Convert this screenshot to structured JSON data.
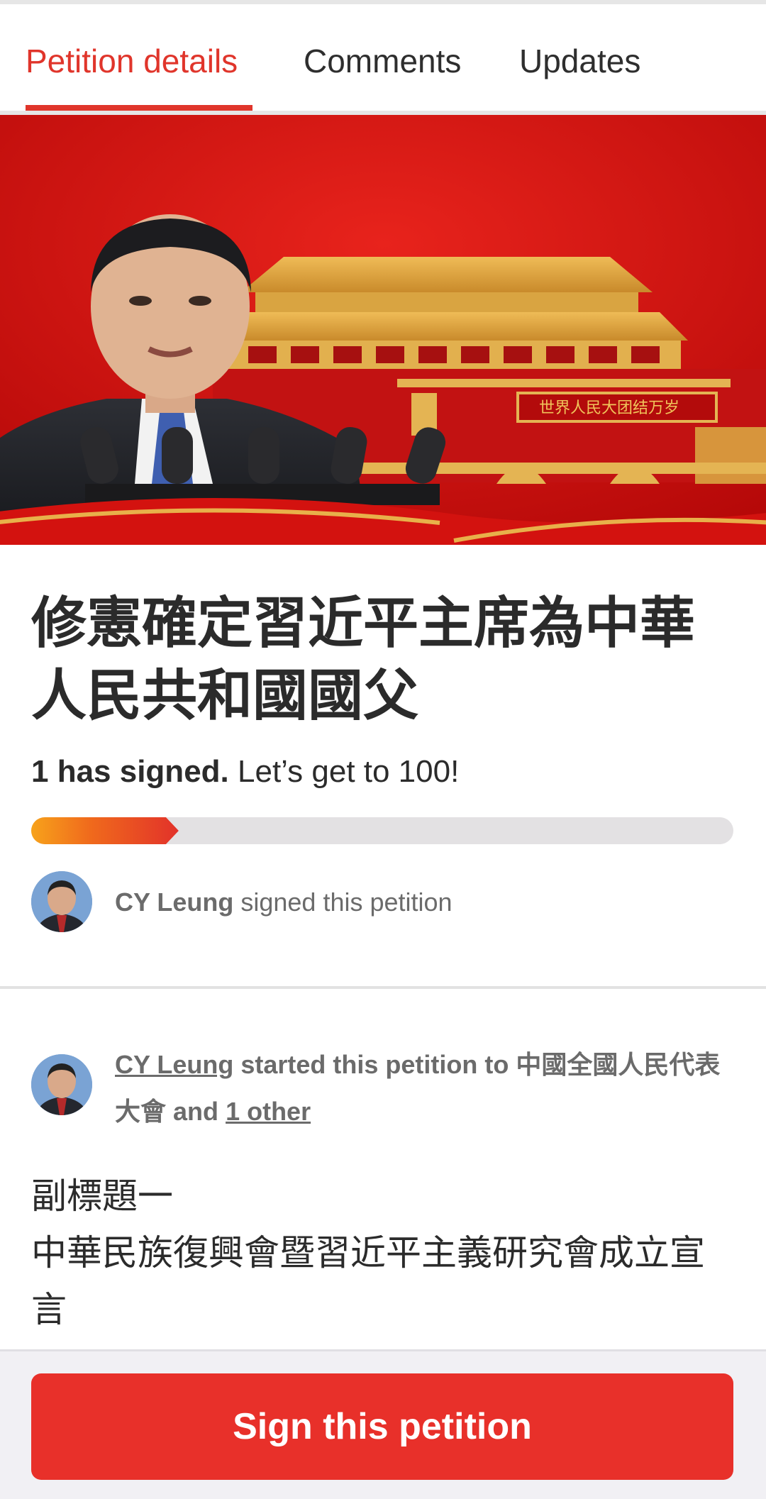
{
  "tabs": [
    {
      "label": "Petition details",
      "active": true
    },
    {
      "label": "Comments",
      "active": false
    },
    {
      "label": "Updates",
      "active": false
    }
  ],
  "hero": {
    "banner_text": "世界人民大团结万岁",
    "colors": {
      "red": "#d81414",
      "gold": "#d9a441"
    }
  },
  "petition": {
    "title": "修憲確定習近平主席為中華人民共和國國父",
    "signed_count_text": "1 has signed.",
    "goal_text": "Let’s get to 100!",
    "progress_fraction": 0.21,
    "recent_signer": {
      "name": "CY Leung",
      "action": "signed this petition"
    },
    "starter": {
      "name": "CY Leung",
      "action": "started this petition to",
      "target": "中國全國人民代表大會",
      "conjunction": "and",
      "others_link": "1 other"
    },
    "body_lines": [
      "副標題一",
      "中華民族復興會暨習近平主義研究會成立宣言"
    ]
  },
  "cta": {
    "label": "Sign this petition",
    "color": "#e8302a"
  },
  "accent_color": "#e0352b"
}
